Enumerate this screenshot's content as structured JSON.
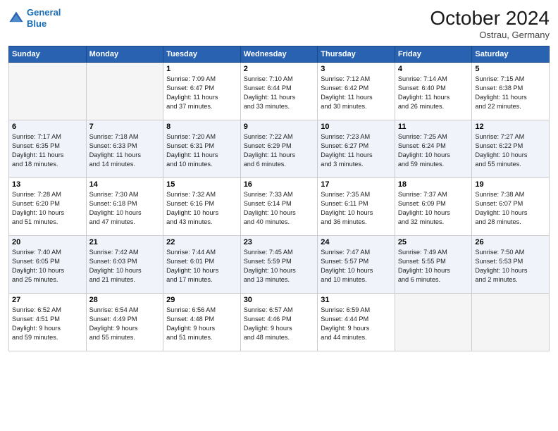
{
  "header": {
    "logo_line1": "General",
    "logo_line2": "Blue",
    "month": "October 2024",
    "location": "Ostrau, Germany"
  },
  "weekdays": [
    "Sunday",
    "Monday",
    "Tuesday",
    "Wednesday",
    "Thursday",
    "Friday",
    "Saturday"
  ],
  "weeks": [
    [
      {
        "day": "",
        "info": ""
      },
      {
        "day": "",
        "info": ""
      },
      {
        "day": "1",
        "info": "Sunrise: 7:09 AM\nSunset: 6:47 PM\nDaylight: 11 hours\nand 37 minutes."
      },
      {
        "day": "2",
        "info": "Sunrise: 7:10 AM\nSunset: 6:44 PM\nDaylight: 11 hours\nand 33 minutes."
      },
      {
        "day": "3",
        "info": "Sunrise: 7:12 AM\nSunset: 6:42 PM\nDaylight: 11 hours\nand 30 minutes."
      },
      {
        "day": "4",
        "info": "Sunrise: 7:14 AM\nSunset: 6:40 PM\nDaylight: 11 hours\nand 26 minutes."
      },
      {
        "day": "5",
        "info": "Sunrise: 7:15 AM\nSunset: 6:38 PM\nDaylight: 11 hours\nand 22 minutes."
      }
    ],
    [
      {
        "day": "6",
        "info": "Sunrise: 7:17 AM\nSunset: 6:35 PM\nDaylight: 11 hours\nand 18 minutes."
      },
      {
        "day": "7",
        "info": "Sunrise: 7:18 AM\nSunset: 6:33 PM\nDaylight: 11 hours\nand 14 minutes."
      },
      {
        "day": "8",
        "info": "Sunrise: 7:20 AM\nSunset: 6:31 PM\nDaylight: 11 hours\nand 10 minutes."
      },
      {
        "day": "9",
        "info": "Sunrise: 7:22 AM\nSunset: 6:29 PM\nDaylight: 11 hours\nand 6 minutes."
      },
      {
        "day": "10",
        "info": "Sunrise: 7:23 AM\nSunset: 6:27 PM\nDaylight: 11 hours\nand 3 minutes."
      },
      {
        "day": "11",
        "info": "Sunrise: 7:25 AM\nSunset: 6:24 PM\nDaylight: 10 hours\nand 59 minutes."
      },
      {
        "day": "12",
        "info": "Sunrise: 7:27 AM\nSunset: 6:22 PM\nDaylight: 10 hours\nand 55 minutes."
      }
    ],
    [
      {
        "day": "13",
        "info": "Sunrise: 7:28 AM\nSunset: 6:20 PM\nDaylight: 10 hours\nand 51 minutes."
      },
      {
        "day": "14",
        "info": "Sunrise: 7:30 AM\nSunset: 6:18 PM\nDaylight: 10 hours\nand 47 minutes."
      },
      {
        "day": "15",
        "info": "Sunrise: 7:32 AM\nSunset: 6:16 PM\nDaylight: 10 hours\nand 43 minutes."
      },
      {
        "day": "16",
        "info": "Sunrise: 7:33 AM\nSunset: 6:14 PM\nDaylight: 10 hours\nand 40 minutes."
      },
      {
        "day": "17",
        "info": "Sunrise: 7:35 AM\nSunset: 6:11 PM\nDaylight: 10 hours\nand 36 minutes."
      },
      {
        "day": "18",
        "info": "Sunrise: 7:37 AM\nSunset: 6:09 PM\nDaylight: 10 hours\nand 32 minutes."
      },
      {
        "day": "19",
        "info": "Sunrise: 7:38 AM\nSunset: 6:07 PM\nDaylight: 10 hours\nand 28 minutes."
      }
    ],
    [
      {
        "day": "20",
        "info": "Sunrise: 7:40 AM\nSunset: 6:05 PM\nDaylight: 10 hours\nand 25 minutes."
      },
      {
        "day": "21",
        "info": "Sunrise: 7:42 AM\nSunset: 6:03 PM\nDaylight: 10 hours\nand 21 minutes."
      },
      {
        "day": "22",
        "info": "Sunrise: 7:44 AM\nSunset: 6:01 PM\nDaylight: 10 hours\nand 17 minutes."
      },
      {
        "day": "23",
        "info": "Sunrise: 7:45 AM\nSunset: 5:59 PM\nDaylight: 10 hours\nand 13 minutes."
      },
      {
        "day": "24",
        "info": "Sunrise: 7:47 AM\nSunset: 5:57 PM\nDaylight: 10 hours\nand 10 minutes."
      },
      {
        "day": "25",
        "info": "Sunrise: 7:49 AM\nSunset: 5:55 PM\nDaylight: 10 hours\nand 6 minutes."
      },
      {
        "day": "26",
        "info": "Sunrise: 7:50 AM\nSunset: 5:53 PM\nDaylight: 10 hours\nand 2 minutes."
      }
    ],
    [
      {
        "day": "27",
        "info": "Sunrise: 6:52 AM\nSunset: 4:51 PM\nDaylight: 9 hours\nand 59 minutes."
      },
      {
        "day": "28",
        "info": "Sunrise: 6:54 AM\nSunset: 4:49 PM\nDaylight: 9 hours\nand 55 minutes."
      },
      {
        "day": "29",
        "info": "Sunrise: 6:56 AM\nSunset: 4:48 PM\nDaylight: 9 hours\nand 51 minutes."
      },
      {
        "day": "30",
        "info": "Sunrise: 6:57 AM\nSunset: 4:46 PM\nDaylight: 9 hours\nand 48 minutes."
      },
      {
        "day": "31",
        "info": "Sunrise: 6:59 AM\nSunset: 4:44 PM\nDaylight: 9 hours\nand 44 minutes."
      },
      {
        "day": "",
        "info": ""
      },
      {
        "day": "",
        "info": ""
      }
    ]
  ]
}
